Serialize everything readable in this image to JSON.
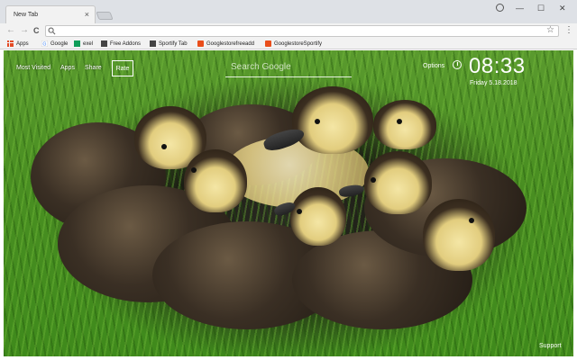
{
  "window": {
    "tab_title": "New Tab",
    "tab_close": "×",
    "minimize": "—",
    "maximize": "☐",
    "close": "✕"
  },
  "toolbar": {
    "back": "←",
    "forward": "→",
    "reload": "C",
    "omnibox_value": "",
    "star": "☆",
    "menu": "⋮"
  },
  "bookmarks": [
    {
      "label": "Apps",
      "icon": "apps-icon"
    },
    {
      "label": "Google",
      "icon": "google-icon"
    },
    {
      "label": "exel",
      "icon": "sheets-icon"
    },
    {
      "label": "Free Addons",
      "icon": "page-icon"
    },
    {
      "label": "Sportify Tab",
      "icon": "page-icon"
    },
    {
      "label": "Googlestorefreeadd",
      "icon": "store-icon"
    },
    {
      "label": "GooglestoreSportify",
      "icon": "store-icon"
    }
  ],
  "newtab": {
    "links": [
      "Most Visited",
      "Apps",
      "Share"
    ],
    "rate_label": "Rate",
    "search_placeholder": "Search Google",
    "options_label": "Options",
    "time": "08:33",
    "date": "Friday  5.18.2018",
    "support_label": "Support"
  },
  "colors": {
    "chrome_frame": "#dee1e6",
    "toolbar": "#f2f2f2",
    "overlay_text": "#ffffff",
    "grass": "#4a8f22"
  }
}
